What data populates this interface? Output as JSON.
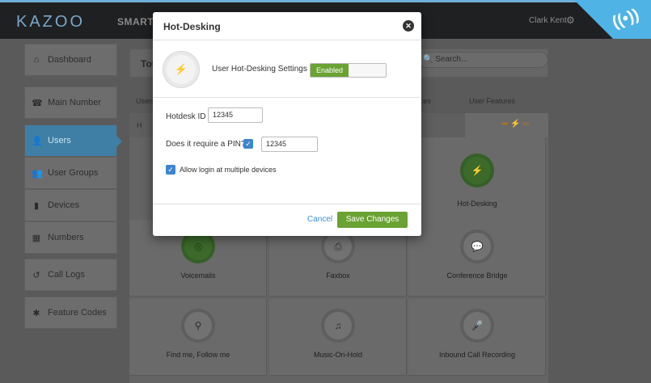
{
  "topbar": {
    "logo": "KAZOO",
    "app_title": "SMART P",
    "user_name": "Clark Kent",
    "gear_icon": "⚙",
    "corner_icon": "((•))"
  },
  "sidebar": {
    "items": [
      {
        "label": "Dashboard",
        "icon": "⌂"
      },
      {
        "label": "Main Number",
        "icon": "☎"
      },
      {
        "label": "Users",
        "icon": "👤"
      },
      {
        "label": "User Groups",
        "icon": "👥"
      },
      {
        "label": "Devices",
        "icon": "▮"
      },
      {
        "label": "Numbers",
        "icon": "▦"
      },
      {
        "label": "Call Logs",
        "icon": "↺"
      },
      {
        "label": "Feature Codes",
        "icon": "✱"
      }
    ]
  },
  "main": {
    "title": "Tot",
    "search_placeholder": "Search...",
    "tabs": [
      "Users",
      "ces",
      "User Features"
    ],
    "subhead": "H",
    "features": [
      {
        "label": "Hot-Desking",
        "icon": "⚡"
      },
      {
        "label": "Voicemails",
        "icon": "◎"
      },
      {
        "label": "Faxbox",
        "icon": "⎙"
      },
      {
        "label": "Conference Bridge",
        "icon": "💬"
      },
      {
        "label": "Find me, Follow me",
        "icon": "⚲"
      },
      {
        "label": "Music-On-Hold",
        "icon": "♫"
      },
      {
        "label": "Inbound Call Recording",
        "icon": "🎤"
      }
    ]
  },
  "modal": {
    "title": "Hot-Desking",
    "close_icon": "✕",
    "hotdesk_icon": "⚡",
    "settings_label": "User Hot-Desking Settings",
    "toggle_label": "Enabled",
    "hotdesk_id_label": "Hotdesk ID",
    "hotdesk_id_value": "12345",
    "pin_label": "Does it require a PIN?",
    "pin_checked": true,
    "pin_value": "12345",
    "multi_label": "Allow login at multiple devices",
    "multi_checked": true,
    "cancel_label": "Cancel",
    "save_label": "Save Changes"
  },
  "colors": {
    "accent_green": "#6aa233",
    "accent_blue": "#4fb3e6",
    "checkbox_blue": "#3d86cf"
  }
}
